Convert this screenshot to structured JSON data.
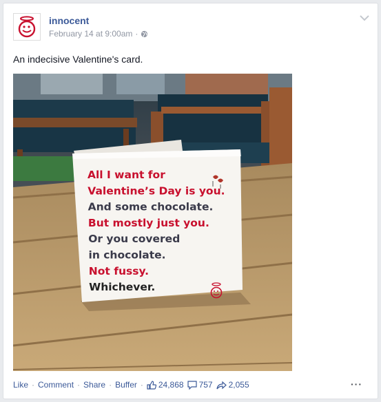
{
  "post": {
    "page_name": "innocent",
    "timestamp": "February 14 at 9:00am",
    "separator": "·",
    "audience_icon": "globe-icon",
    "text": "An indecisive Valentine's card."
  },
  "card_lines": [
    {
      "text": "All I want for",
      "color": "#c8102e"
    },
    {
      "text": "Valentine’s Day is you.",
      "color": "#c8102e"
    },
    {
      "text": "And some chocolate.",
      "color": "#3a3a4a"
    },
    {
      "text": "But mostly just you.",
      "color": "#c8102e"
    },
    {
      "text": "Or you covered",
      "color": "#3a3a4a"
    },
    {
      "text": "in chocolate.",
      "color": "#3a3a4a"
    },
    {
      "text": "Not fussy.",
      "color": "#c8102e"
    },
    {
      "text": "Whichever.",
      "color": "#222222"
    }
  ],
  "actions": {
    "like": "Like",
    "comment": "Comment",
    "share": "Share",
    "buffer": "Buffer",
    "sep": "·",
    "likes_count": "24,868",
    "comments_count": "757",
    "shares_count": "2,055",
    "more": "···"
  },
  "colors": {
    "brand": "#3b5998",
    "muted": "#9197a3",
    "innocent_red": "#c8102e"
  }
}
